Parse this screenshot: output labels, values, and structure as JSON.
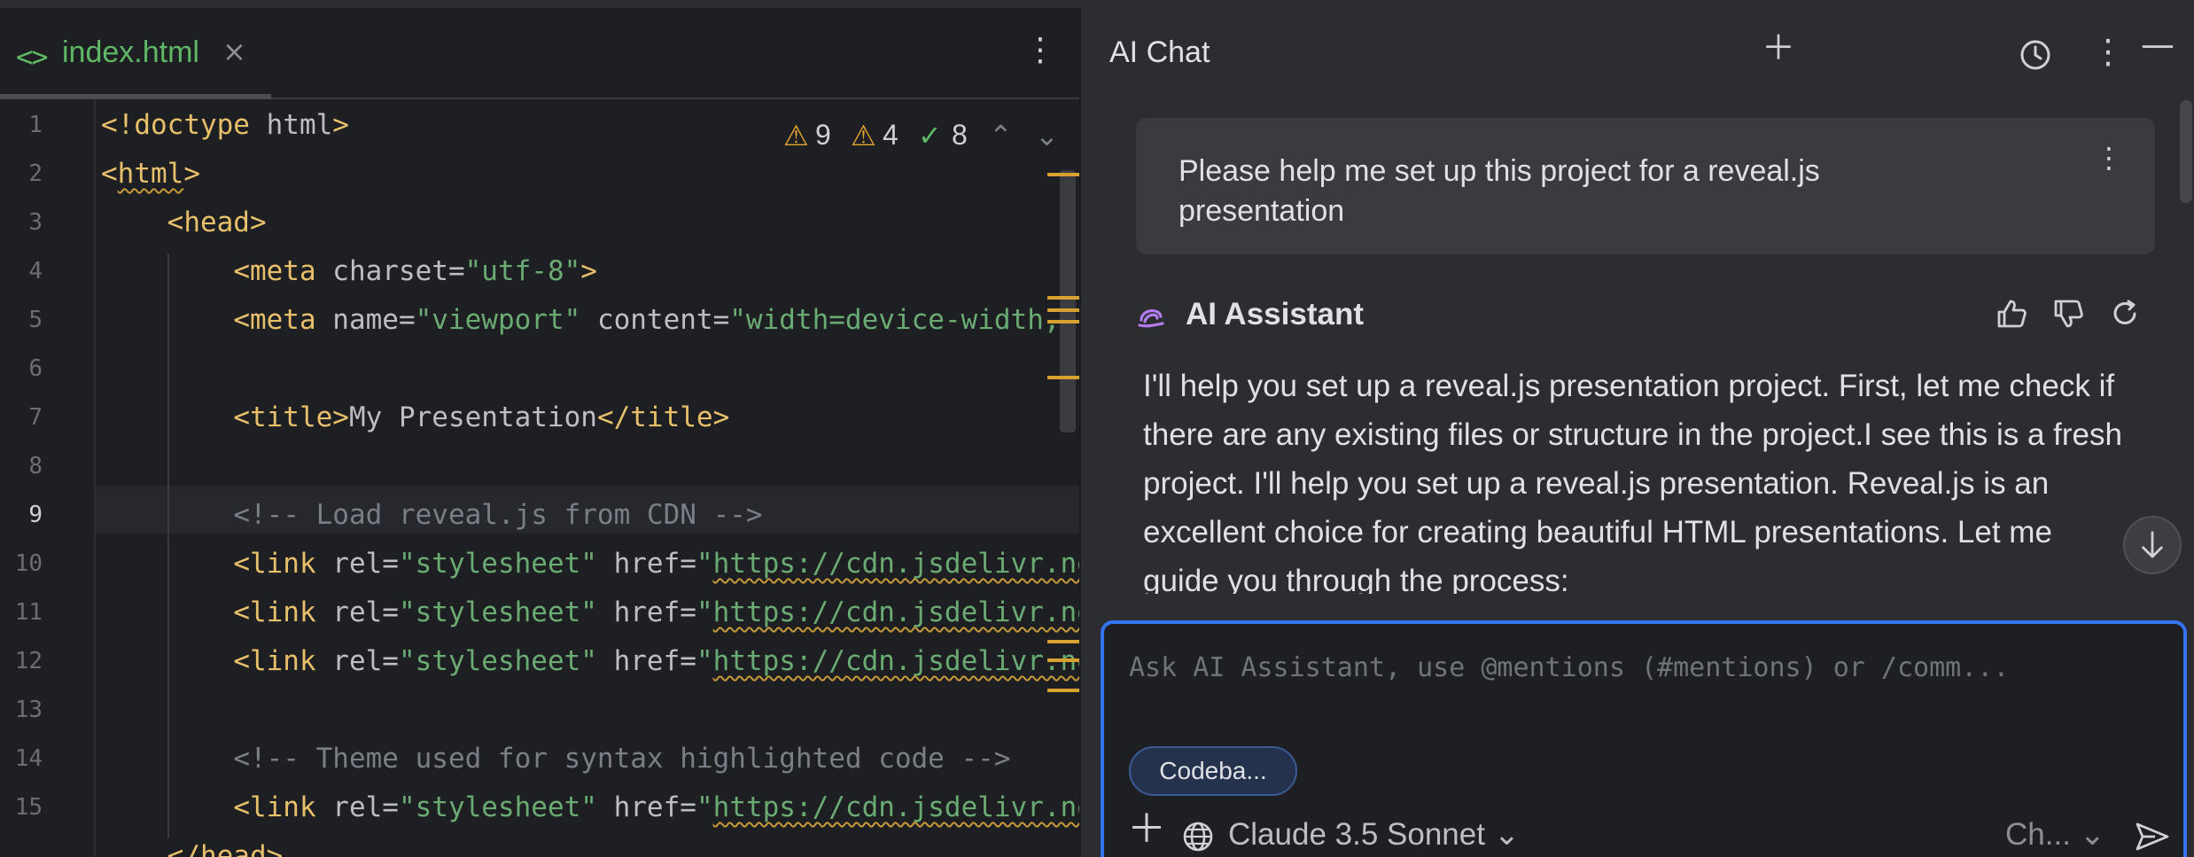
{
  "editor": {
    "tab": {
      "icon": "<>",
      "name": "index.html",
      "close": "×"
    },
    "menu_icon": "⋮",
    "inspections": {
      "warnings_a": "9",
      "warnings_b": "4",
      "ok": "8"
    },
    "line_numbers": [
      "1",
      "2",
      "3",
      "4",
      "5",
      "6",
      "7",
      "8",
      "9",
      "10",
      "11",
      "12",
      "13",
      "14",
      "15"
    ],
    "active_line": "9"
  },
  "chat": {
    "title": "AI Chat",
    "header_icons": [
      "plus-icon",
      "history-icon",
      "more-icon",
      "minimize-icon"
    ],
    "user_message": "Please help me set up this project for a reveal.js presentation",
    "assistant": {
      "name": "AI Assistant",
      "message": "I'll help you set up a reveal.js presentation project. First, let me check if there are any existing files or structure in the project.I see this is a fresh project. I'll help you set up a reveal.js presentation. Reveal.js is an excellent choice for creating beautiful HTML presentations. Let me guide you through the process:"
    },
    "input": {
      "placeholder": "Ask AI Assistant, use @mentions (#mentions) or /comm...",
      "chip": "Codeba...",
      "model": "Claude 3.5 Sonnet",
      "mode": "Ch..."
    },
    "colors": {
      "accent": "#3574f0",
      "assistant_logo": "#b37cf0",
      "warning": "#e5a431",
      "ok": "#5fb865"
    }
  }
}
